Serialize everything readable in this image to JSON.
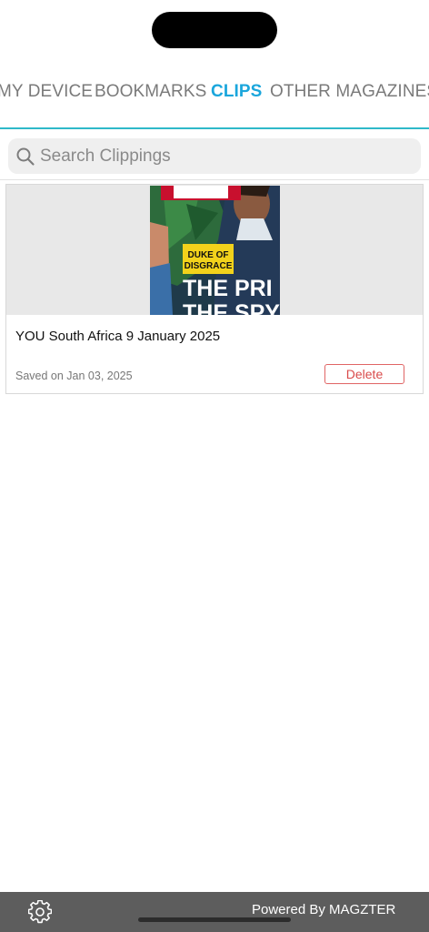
{
  "tabs": [
    {
      "label": "MY DEVICE"
    },
    {
      "label": "BOOKMARKS"
    },
    {
      "label": "CLIPS",
      "active": true
    },
    {
      "label": "OTHER MAGAZINES"
    }
  ],
  "search": {
    "placeholder": "Search Clippings",
    "value": ""
  },
  "clip": {
    "title": "YOU South Africa 9 January 2025",
    "saved": "Saved on Jan 03, 2025",
    "delete_label": "Delete",
    "cover": {
      "badge_line1": "DUKE OF",
      "badge_line2": "DISGRACE",
      "headline_line1": "THE PRI",
      "headline_line2": "THE SPY"
    }
  },
  "footer": {
    "powered_by": "Powered By MAGZTER"
  },
  "colors": {
    "accent": "#1aa6dc",
    "delete": "#d94b4b",
    "footer_bg": "#5d5d5d"
  }
}
